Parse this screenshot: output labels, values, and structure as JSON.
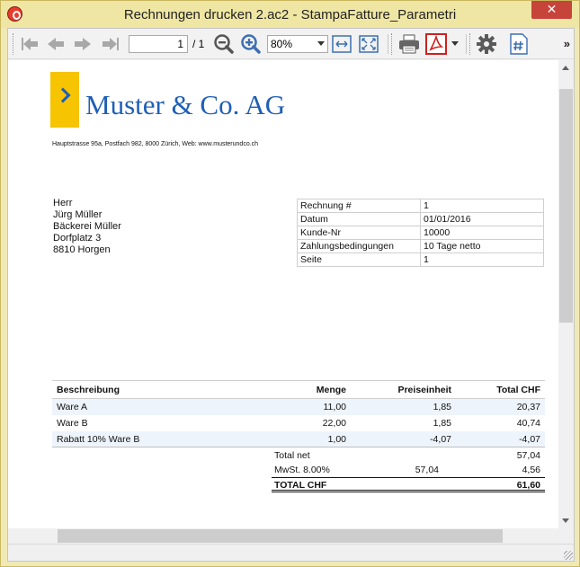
{
  "window": {
    "title": "Rechnungen drucken 2.ac2 - StampaFatture_Parametri",
    "close_label": "✕"
  },
  "toolbar": {
    "page_current": "1",
    "page_total": "/ 1",
    "zoom": "80%",
    "more_label": "»",
    "icons": [
      "first-page-icon",
      "prev-page-icon",
      "next-page-icon",
      "last-page-icon",
      "zoom-out-icon",
      "zoom-in-icon",
      "fit-width-icon",
      "fit-page-icon",
      "print-icon",
      "pdf-icon",
      "dropdown-icon",
      "settings-icon",
      "page-number-icon"
    ]
  },
  "document": {
    "company_name": "Muster & Co. AG",
    "address_line": "Hauptstrasse 95a, Postfach 982, 8000 Zürich, Web: www.musterundco.ch",
    "recipient": [
      "Herr",
      "Jürg Müller",
      "Bäckerei Müller",
      "Dorfplatz 3",
      "8810 Horgen"
    ],
    "info": [
      {
        "label": "Rechnung #",
        "value": "1"
      },
      {
        "label": "Datum",
        "value": "01/01/2016"
      },
      {
        "label": "Kunde-Nr",
        "value": "10000"
      },
      {
        "label": "Zahlungsbedingungen",
        "value": "10 Tage netto"
      },
      {
        "label": "Seite",
        "value": "1"
      }
    ],
    "items_header": {
      "description": "Beschreibung",
      "quantity": "Menge",
      "unit_price": "Preiseinheit",
      "total": "Total CHF"
    },
    "items": [
      {
        "description": "Ware A",
        "quantity": "11,00",
        "unit_price": "1,85",
        "total": "20,37"
      },
      {
        "description": "Ware B",
        "quantity": "22,00",
        "unit_price": "1,85",
        "total": "40,74"
      },
      {
        "description": "Rabatt 10% Ware B",
        "quantity": "1,00",
        "unit_price": "-4,07",
        "total": "-4,07"
      }
    ],
    "totals": [
      {
        "label": "Total net",
        "base": "",
        "value": "57,04"
      },
      {
        "label": "MwSt. 8.00%",
        "base": "57,04",
        "value": "4,56"
      }
    ],
    "grand_total": {
      "label": "TOTAL CHF",
      "value": "61,60"
    }
  },
  "colors": {
    "brand_blue": "#1f5fb6",
    "logo_yellow": "#f6c400",
    "close_red": "#c7443a",
    "pdf_red": "#d0201e"
  }
}
